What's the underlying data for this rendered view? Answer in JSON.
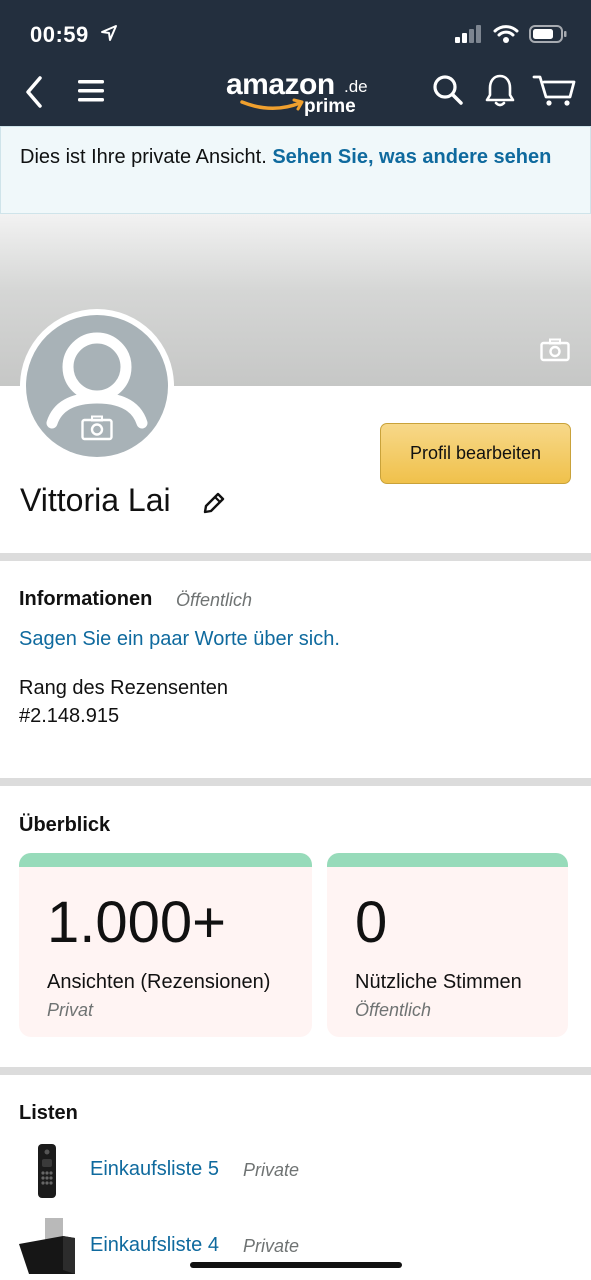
{
  "status_bar": {
    "time": "00:59",
    "icons": [
      "location-arrow-icon",
      "cellular-signal-icon",
      "wifi-icon",
      "battery-icon"
    ]
  },
  "nav": {
    "logo_word": "amazon",
    "logo_tld": ".de",
    "logo_sub": "prime",
    "icons": [
      "back-chevron-icon",
      "hamburger-menu-icon",
      "search-icon",
      "bell-icon",
      "cart-icon"
    ]
  },
  "notice": {
    "text": "Dies ist Ihre private Ansicht.",
    "link": "Sehen Sie, was andere sehen"
  },
  "profile": {
    "name": "Vittoria Lai",
    "edit_button": "Profil bearbeiten"
  },
  "info": {
    "title": "Informationen",
    "visibility": "Öffentlich",
    "about_link": "Sagen Sie ein paar Worte über sich.",
    "rank_label": "Rang des Rezensenten",
    "rank_value": "#2.148.915"
  },
  "overview": {
    "title": "Überblick",
    "cards": [
      {
        "number": "1.000+",
        "label": "Ansichten (Rezensionen)",
        "visibility": "Privat"
      },
      {
        "number": "0",
        "label": "Nützliche Stimmen",
        "visibility": "Öffentlich"
      }
    ]
  },
  "lists": {
    "title": "Listen",
    "items": [
      {
        "name": "Einkaufsliste 5",
        "visibility": "Private"
      },
      {
        "name": "Einkaufsliste 4",
        "visibility": "Private"
      }
    ]
  },
  "colors": {
    "header_bg": "#232f3e",
    "link": "#0f6a9e",
    "button": "#f0c14b",
    "card_bg": "#fff4f3",
    "card_accent": "#97dbba"
  }
}
